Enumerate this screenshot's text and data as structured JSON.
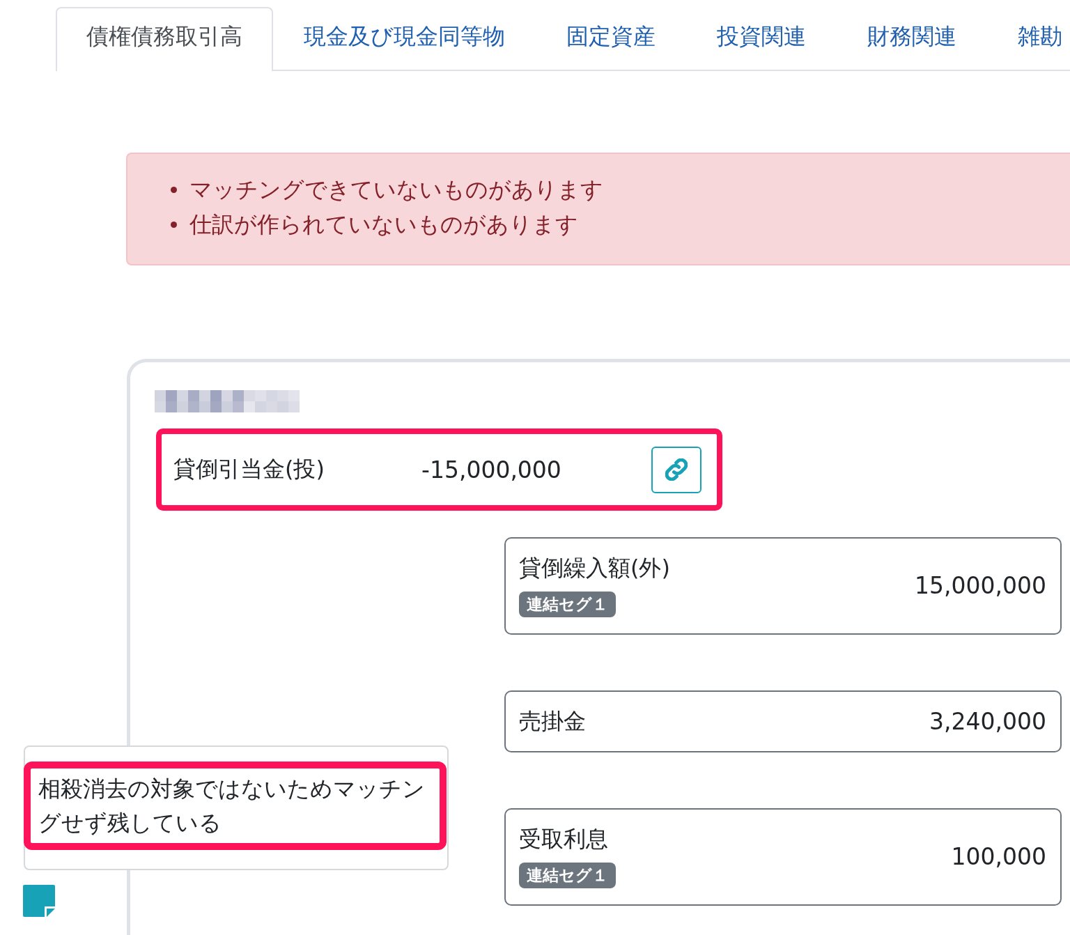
{
  "tabs": [
    {
      "label": "債権債務取引高",
      "selected": true
    },
    {
      "label": "現金及び現金同等物",
      "selected": false
    },
    {
      "label": "固定資産",
      "selected": false
    },
    {
      "label": "投資関連",
      "selected": false
    },
    {
      "label": "財務関連",
      "selected": false
    },
    {
      "label": "雑勘",
      "selected": false
    }
  ],
  "alert": {
    "messages": [
      "マッチングできていないものがあります",
      "仕訳が作られていないものがあります"
    ]
  },
  "card": {
    "source_entry": {
      "account": "貸倒引当金(投)",
      "amount": "-15,000,000",
      "highlighted": true
    },
    "matches": [
      {
        "account": "貸倒繰入額(外)",
        "badge": "連結セグ１",
        "amount": "15,000,000"
      },
      {
        "account": "売掛金",
        "amount": "3,240,000"
      },
      {
        "account": "受取利息",
        "badge": "連結セグ１",
        "amount": "100,000"
      }
    ]
  },
  "note": {
    "text": "相殺消去の対象ではないためマッチングせず残している",
    "highlighted": true
  }
}
